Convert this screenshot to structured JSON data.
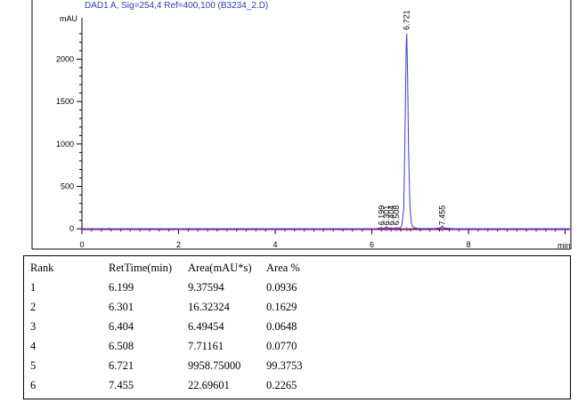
{
  "chart_data": {
    "type": "line",
    "title": "DAD1 A, Sig=254,4 Ref=400,100 (B3234_2.D)",
    "ylabel": "mAU",
    "xlabel": "min",
    "xlim": [
      0,
      10.1
    ],
    "ylim": [
      -50,
      2550
    ],
    "x_ticks": [
      0,
      2,
      4,
      6,
      8
    ],
    "y_ticks": [
      0,
      500,
      1000,
      1500,
      2000
    ],
    "x_minor_step": 0.2,
    "y_minor_step": 100,
    "grid": false,
    "series": [
      {
        "x": [
          0,
          0.5,
          0.55,
          0.6,
          1.0,
          2.0,
          3.0,
          4.0,
          5.0,
          5.8,
          6.1,
          6.199,
          6.25,
          6.301,
          6.35,
          6.404,
          6.45,
          6.508,
          6.58,
          6.62,
          6.66,
          6.69,
          6.71,
          6.721,
          6.74,
          6.76,
          6.79,
          6.82,
          6.86,
          6.95,
          7.3,
          7.42,
          7.455,
          7.5,
          7.7,
          8.5,
          9.5,
          10.1
        ],
        "y": [
          0,
          0,
          6,
          0,
          0,
          0,
          0,
          0,
          0,
          0,
          2,
          14,
          4,
          24,
          6,
          12,
          5,
          12,
          10,
          35,
          250,
          1300,
          2150,
          2300,
          1800,
          900,
          250,
          60,
          15,
          4,
          3,
          12,
          32,
          10,
          2,
          0,
          0,
          0
        ]
      }
    ],
    "peaks": [
      {
        "label": "6.199",
        "x": 6.199
      },
      {
        "label": "6.301",
        "x": 6.301
      },
      {
        "label": "6.404",
        "x": 6.404
      },
      {
        "label": "6.508",
        "x": 6.508
      },
      {
        "label": "6.721",
        "x": 6.721
      },
      {
        "label": "7.455",
        "x": 7.455
      }
    ],
    "colors": {
      "trace": "#3b3bd6",
      "baseline": "#c02a9a",
      "title": "#2b3fb5",
      "axis": "#000000"
    }
  },
  "table": {
    "headers": [
      "Rank",
      "RetTime(min)",
      "Area(mAU*s)",
      "Area %"
    ],
    "rows": [
      [
        "1",
        "6.199",
        "9.37594",
        "0.0936"
      ],
      [
        "2",
        "6.301",
        "16.32324",
        "0.1629"
      ],
      [
        "3",
        "6.404",
        "6.49454",
        "0.0648"
      ],
      [
        "4",
        "6.508",
        "7.71161",
        "0.0770"
      ],
      [
        "5",
        "6.721",
        "9958.75000",
        "99.3753"
      ],
      [
        "6",
        "7.455",
        "22.69601",
        "0.2265"
      ]
    ]
  }
}
